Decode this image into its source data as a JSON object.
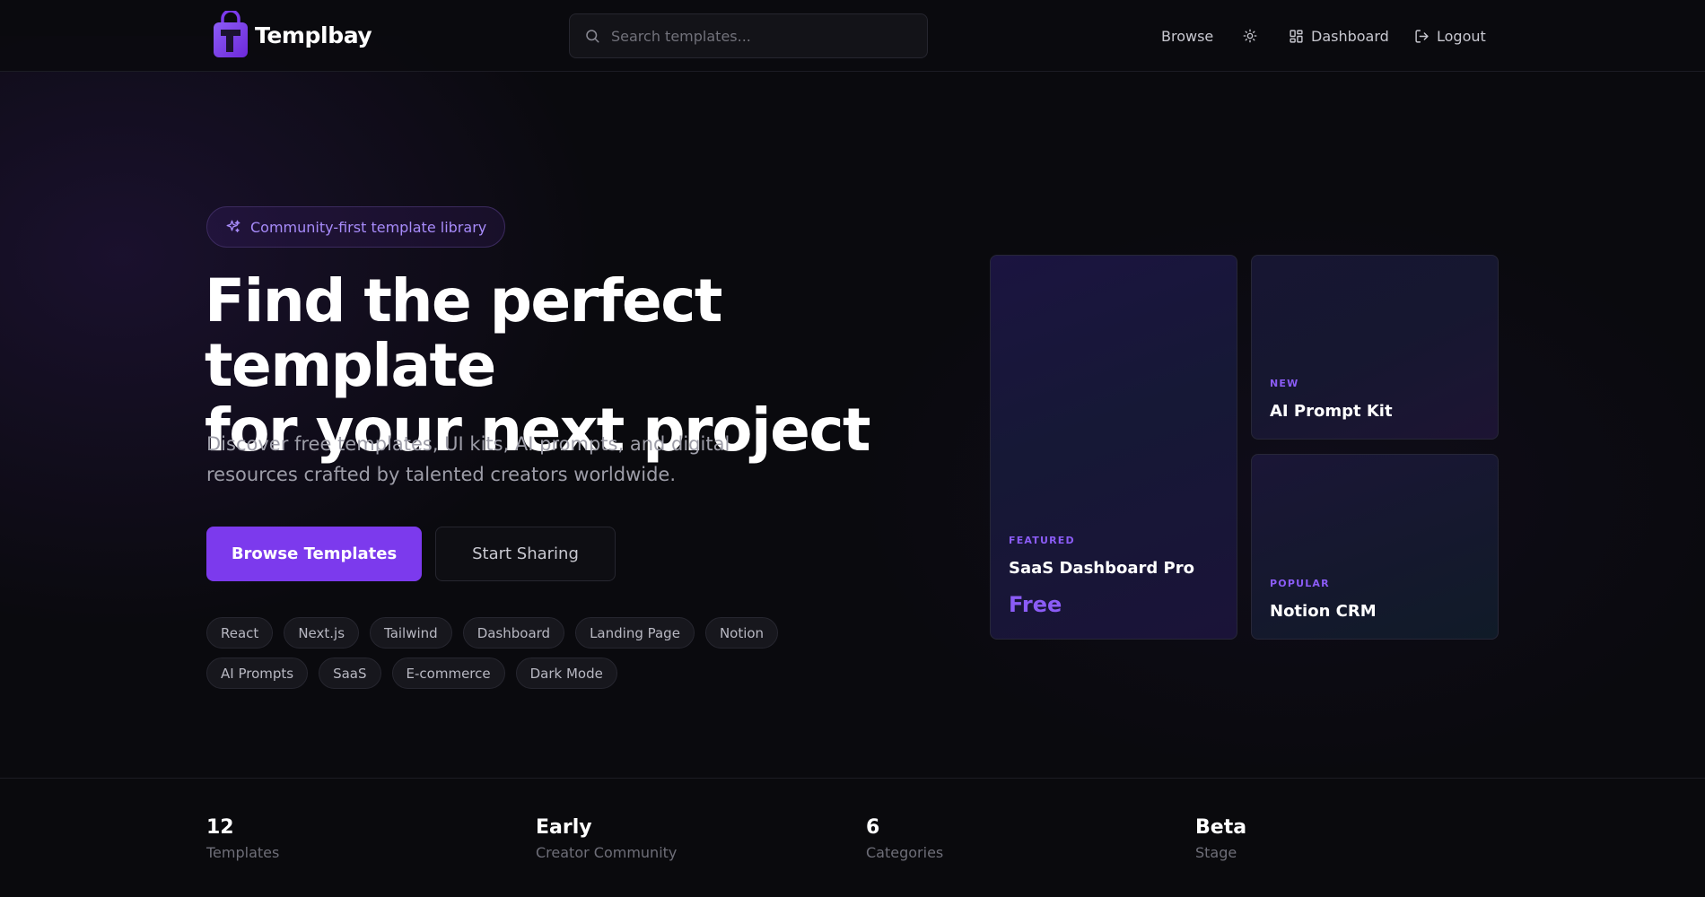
{
  "header": {
    "brand": "Templbay",
    "search_placeholder": "Search templates...",
    "nav": {
      "browse": "Browse",
      "dashboard": "Dashboard",
      "logout": "Logout"
    },
    "icons": [
      "search-icon",
      "sun-icon",
      "dashboard-grid-icon",
      "logout-icon"
    ]
  },
  "hero": {
    "badge": "Community-first template library",
    "title_line1": "Find the perfect template",
    "title_line2": "for your next project",
    "subtitle": "Discover free templates, UI kits, AI prompts, and digital resources crafted by talented creators worldwide.",
    "primary_cta": "Browse Templates",
    "secondary_cta": "Start Sharing",
    "tags": [
      "React",
      "Next.js",
      "Tailwind",
      "Dashboard",
      "Landing Page",
      "Notion",
      "AI Prompts",
      "SaaS",
      "E-commerce",
      "Dark Mode"
    ]
  },
  "cards": {
    "featured": {
      "label": "FEATURED",
      "title": "SaaS Dashboard Pro",
      "price": "Free"
    },
    "new": {
      "label": "NEW",
      "title": "AI Prompt Kit"
    },
    "popular": {
      "label": "POPULAR",
      "title": "Notion CRM"
    }
  },
  "stats": [
    {
      "value": "12",
      "label": "Templates"
    },
    {
      "value": "Early",
      "label": "Creator Community"
    },
    {
      "value": "6",
      "label": "Categories"
    },
    {
      "value": "Beta",
      "label": "Stage"
    }
  ],
  "colors": {
    "accent": "#7c3aed",
    "accent_text": "#8b5cf6",
    "background": "#0a0a0e"
  }
}
